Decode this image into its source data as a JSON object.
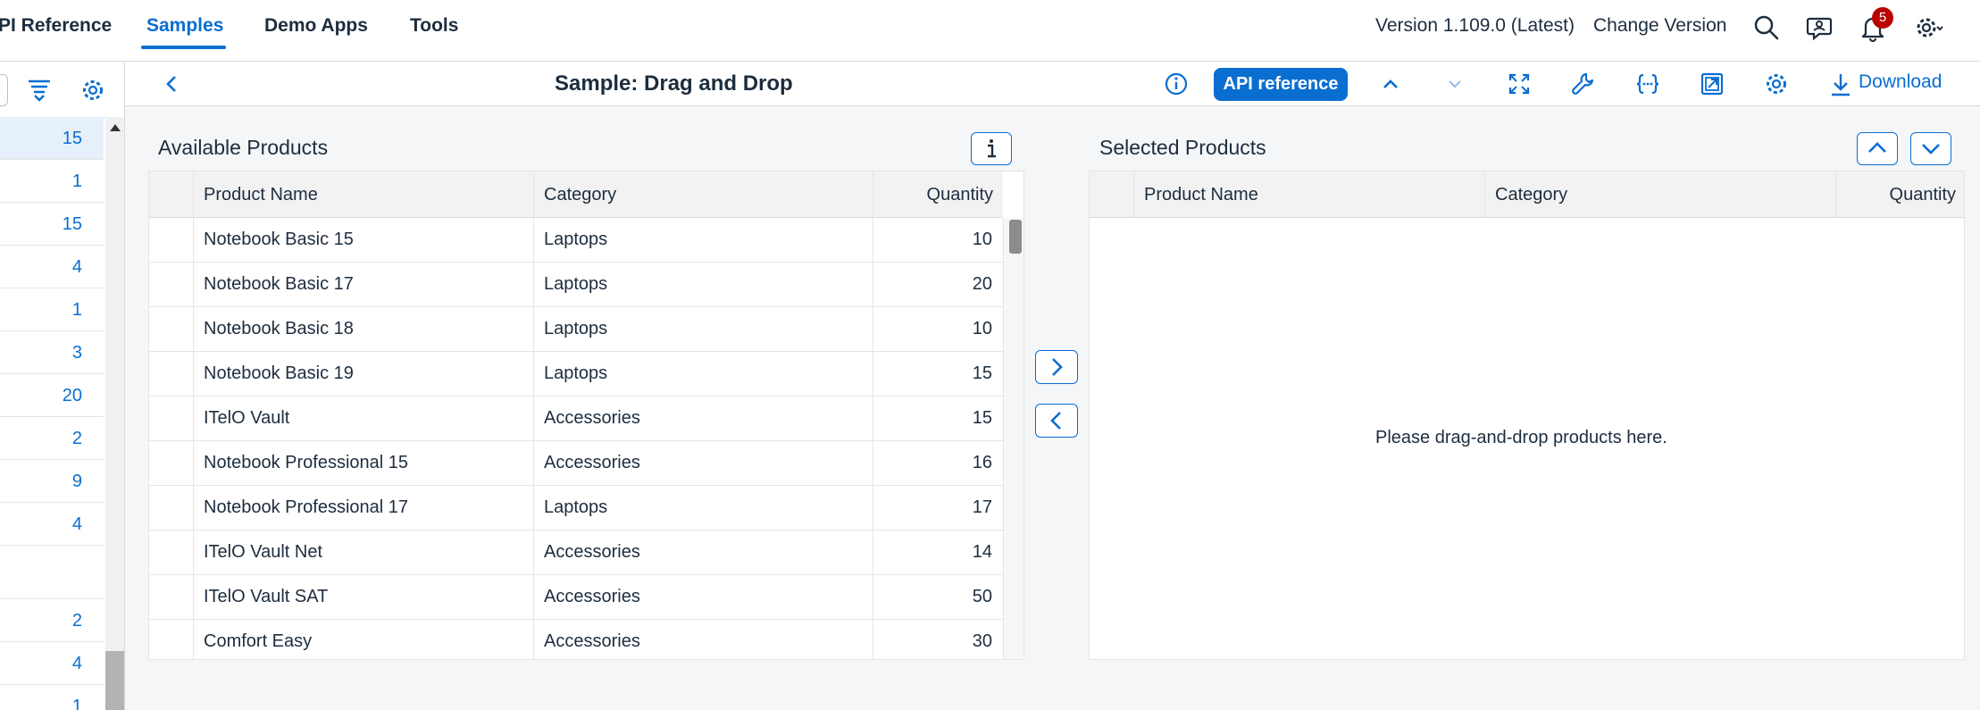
{
  "topnav": {
    "items": [
      "PI Reference",
      "Samples",
      "Demo Apps",
      "Tools"
    ],
    "version": "Version 1.109.0 (Latest)",
    "change_version": "Change Version",
    "notification_count": "5"
  },
  "left_list": {
    "values": [
      "15",
      "1",
      "15",
      "4",
      "1",
      "3",
      "20",
      "2",
      "9",
      "4",
      "",
      "2",
      "4",
      "1"
    ]
  },
  "sample_header": {
    "title": "Sample: Drag and Drop",
    "api_reference": "API reference",
    "download": "Download"
  },
  "available": {
    "title": "Available Products",
    "columns": [
      "Product Name",
      "Category",
      "Quantity"
    ],
    "rows": [
      {
        "name": "Notebook Basic 15",
        "category": "Laptops",
        "quantity": "10"
      },
      {
        "name": "Notebook Basic 17",
        "category": "Laptops",
        "quantity": "20"
      },
      {
        "name": "Notebook Basic 18",
        "category": "Laptops",
        "quantity": "10"
      },
      {
        "name": "Notebook Basic 19",
        "category": "Laptops",
        "quantity": "15"
      },
      {
        "name": "ITelO Vault",
        "category": "Accessories",
        "quantity": "15"
      },
      {
        "name": "Notebook Professional 15",
        "category": "Accessories",
        "quantity": "16"
      },
      {
        "name": "Notebook Professional 17",
        "category": "Laptops",
        "quantity": "17"
      },
      {
        "name": "ITelO Vault Net",
        "category": "Accessories",
        "quantity": "14"
      },
      {
        "name": "ITelO Vault SAT",
        "category": "Accessories",
        "quantity": "50"
      },
      {
        "name": "Comfort Easy",
        "category": "Accessories",
        "quantity": "30"
      }
    ]
  },
  "selected": {
    "title": "Selected Products",
    "columns": [
      "Product Name",
      "Category",
      "Quantity"
    ],
    "empty_text": "Please drag-and-drop products here."
  },
  "colors": {
    "accent": "#0a6ed1",
    "badge": "#bb0000",
    "selected_row": "#e5f0fa"
  }
}
